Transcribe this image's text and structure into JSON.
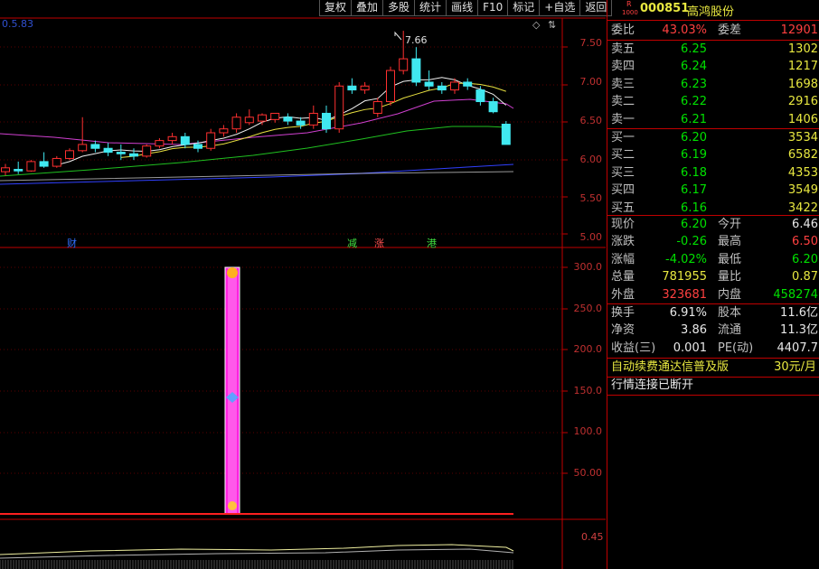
{
  "toolbar": [
    "复权",
    "叠加",
    "多股",
    "统计",
    "画线",
    "F10",
    "标记",
    "+自选",
    "返回"
  ],
  "top_indicator": "0.5.83",
  "stock": {
    "code": "000851",
    "name": "高鸿股份",
    "badge_top": "R",
    "badge_bottom": "1000"
  },
  "price_axis": [
    "7.50",
    "7.00",
    "6.50",
    "6.00",
    "5.50",
    "5.00"
  ],
  "high_marker": "7.66",
  "event_tags": [
    "财",
    "减",
    "涨",
    "港"
  ],
  "lower_axis": [
    "300.0",
    "250.0",
    "200.0",
    "150.0",
    "100.0",
    "50.00"
  ],
  "bottom_axis": "0.45",
  "order_book": {
    "ratio_label": "委比",
    "ratio": "43.03%",
    "diff_label": "委差",
    "diff": "12901",
    "sells": [
      {
        "label": "卖五",
        "price": "6.25",
        "vol": "1302"
      },
      {
        "label": "卖四",
        "price": "6.24",
        "vol": "1217"
      },
      {
        "label": "卖三",
        "price": "6.23",
        "vol": "1698"
      },
      {
        "label": "卖二",
        "price": "6.22",
        "vol": "2916"
      },
      {
        "label": "卖一",
        "price": "6.21",
        "vol": "1406"
      }
    ],
    "buys": [
      {
        "label": "买一",
        "price": "6.20",
        "vol": "3534"
      },
      {
        "label": "买二",
        "price": "6.19",
        "vol": "6582"
      },
      {
        "label": "买三",
        "price": "6.18",
        "vol": "4353"
      },
      {
        "label": "买四",
        "price": "6.17",
        "vol": "3549"
      },
      {
        "label": "买五",
        "price": "6.16",
        "vol": "3422"
      }
    ]
  },
  "quote": [
    {
      "l1": "现价",
      "v1": "6.20",
      "c1": "green",
      "l2": "今开",
      "v2": "6.46",
      "c2": "white"
    },
    {
      "l1": "涨跌",
      "v1": "-0.26",
      "c1": "green",
      "l2": "最高",
      "v2": "6.50",
      "c2": "red"
    },
    {
      "l1": "涨幅",
      "v1": "-4.02%",
      "c1": "green",
      "l2": "最低",
      "v2": "6.20",
      "c2": "green"
    },
    {
      "l1": "总量",
      "v1": "781955",
      "c1": "yellow",
      "l2": "量比",
      "v2": "0.87",
      "c2": "yellow"
    },
    {
      "l1": "外盘",
      "v1": "323681",
      "c1": "red",
      "l2": "内盘",
      "v2": "458274",
      "c2": "green"
    }
  ],
  "fundamentals": [
    {
      "l1": "换手",
      "v1": "6.91%",
      "l2": "股本",
      "v2": "11.6亿"
    },
    {
      "l1": "净资",
      "v1": "3.86",
      "l2": "流通",
      "v2": "11.3亿"
    },
    {
      "l1": "收益(三)",
      "v1": "0.001",
      "l2": "PE(动)",
      "v2": "4407.7"
    }
  ],
  "promo": {
    "text": "自动续费通达信普及版",
    "price": "30元/月"
  },
  "status": "行情连接已断开",
  "chart_data": {
    "type": "candlestick",
    "ylim": [
      4.9,
      7.8
    ],
    "candles": [
      [
        5.85,
        5.95,
        5.8,
        5.9
      ],
      [
        5.88,
        5.98,
        5.82,
        5.86
      ],
      [
        5.86,
        6.0,
        5.85,
        5.98
      ],
      [
        5.98,
        6.1,
        5.9,
        5.92
      ],
      [
        5.92,
        6.05,
        5.9,
        6.02
      ],
      [
        6.02,
        6.15,
        6.0,
        6.12
      ],
      [
        6.12,
        6.55,
        6.1,
        6.2
      ],
      [
        6.2,
        6.25,
        6.1,
        6.15
      ],
      [
        6.15,
        6.22,
        6.05,
        6.1
      ],
      [
        6.1,
        6.2,
        6.0,
        6.08
      ],
      [
        6.08,
        6.15,
        6.0,
        6.05
      ],
      [
        6.05,
        6.2,
        6.03,
        6.18
      ],
      [
        6.18,
        6.28,
        6.15,
        6.25
      ],
      [
        6.25,
        6.35,
        6.2,
        6.3
      ],
      [
        6.3,
        6.35,
        6.15,
        6.2
      ],
      [
        6.2,
        6.25,
        6.1,
        6.15
      ],
      [
        6.15,
        6.4,
        6.12,
        6.35
      ],
      [
        6.35,
        6.45,
        6.3,
        6.4
      ],
      [
        6.4,
        6.6,
        6.35,
        6.55
      ],
      [
        6.48,
        6.65,
        6.45,
        6.55
      ],
      [
        6.5,
        6.6,
        6.45,
        6.58
      ],
      [
        6.52,
        6.6,
        6.48,
        6.6
      ],
      [
        6.55,
        6.6,
        6.45,
        6.5
      ],
      [
        6.5,
        6.55,
        6.4,
        6.45
      ],
      [
        6.45,
        6.7,
        6.4,
        6.6
      ],
      [
        6.6,
        6.7,
        6.35,
        6.4
      ],
      [
        6.4,
        7.0,
        6.35,
        6.95
      ],
      [
        6.95,
        7.05,
        6.85,
        6.9
      ],
      [
        6.9,
        7.0,
        6.85,
        6.95
      ],
      [
        6.6,
        6.8,
        6.55,
        6.75
      ],
      [
        6.75,
        7.2,
        6.7,
        7.15
      ],
      [
        7.15,
        7.66,
        7.1,
        7.3
      ],
      [
        7.3,
        7.45,
        6.95,
        7.0
      ],
      [
        7.0,
        7.15,
        6.9,
        6.95
      ],
      [
        6.95,
        7.0,
        6.85,
        6.9
      ],
      [
        6.9,
        7.05,
        6.85,
        7.0
      ],
      [
        7.0,
        7.05,
        6.9,
        6.95
      ],
      [
        6.9,
        6.95,
        6.7,
        6.75
      ],
      [
        6.75,
        6.8,
        6.6,
        6.62
      ],
      [
        6.46,
        6.5,
        6.2,
        6.2
      ]
    ]
  }
}
